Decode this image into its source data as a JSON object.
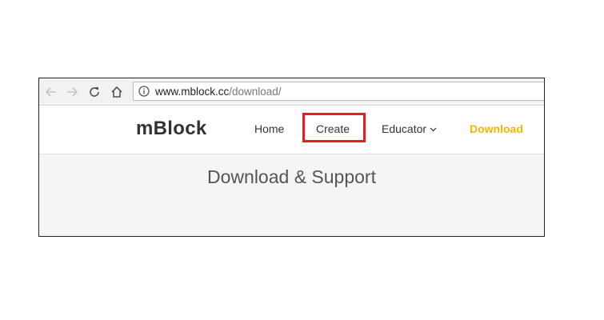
{
  "browser": {
    "url_domain": "www.mblock.cc",
    "url_path": "/download/"
  },
  "site": {
    "logo": "mBlock",
    "nav": {
      "home": "Home",
      "create": "Create",
      "educator": "Educator",
      "download": "Download"
    },
    "heading": "Download & Support"
  },
  "colors": {
    "highlight_box": "#e31e24",
    "download_accent": "#f2b600"
  }
}
